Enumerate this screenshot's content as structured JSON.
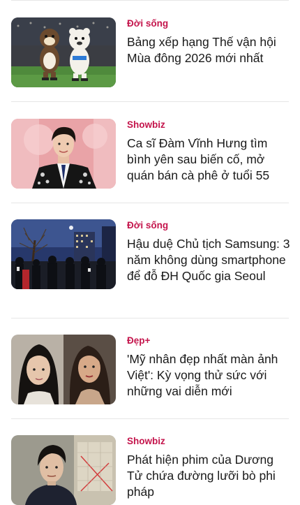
{
  "articles": [
    {
      "category": "Đời sống",
      "title": "Bảng xếp hạng Thế vận hội Mùa đông 2026 mới nhất",
      "image_icon": "olympic-mascots-image"
    },
    {
      "category": "Showbiz",
      "title": "Ca sĩ Đàm Vĩnh Hưng tìm bình yên sau biến cố, mở quán bán cà phê ở tuổi 55",
      "image_icon": "singer-portrait-image"
    },
    {
      "category": "Đời sống",
      "title": "Hậu duệ Chủ tịch Samsung: 3 năm không dùng smartphone để đỗ ĐH Quốc gia Seoul",
      "image_icon": "night-street-crowd-image"
    },
    {
      "category": "Đẹp+",
      "title": "'Mỹ nhân đẹp nhất màn ảnh Việt': Kỳ vọng thử sức với những vai diễn mới",
      "image_icon": "actress-then-now-image"
    },
    {
      "category": "Showbiz",
      "title": "Phát hiện phim của Dương Tử chứa đường lưỡi bò phi pháp",
      "image_icon": "film-still-actress-image"
    }
  ],
  "colors": {
    "category": "#c4154c",
    "title": "#1a1a1a",
    "divider": "#e6e6e6"
  }
}
